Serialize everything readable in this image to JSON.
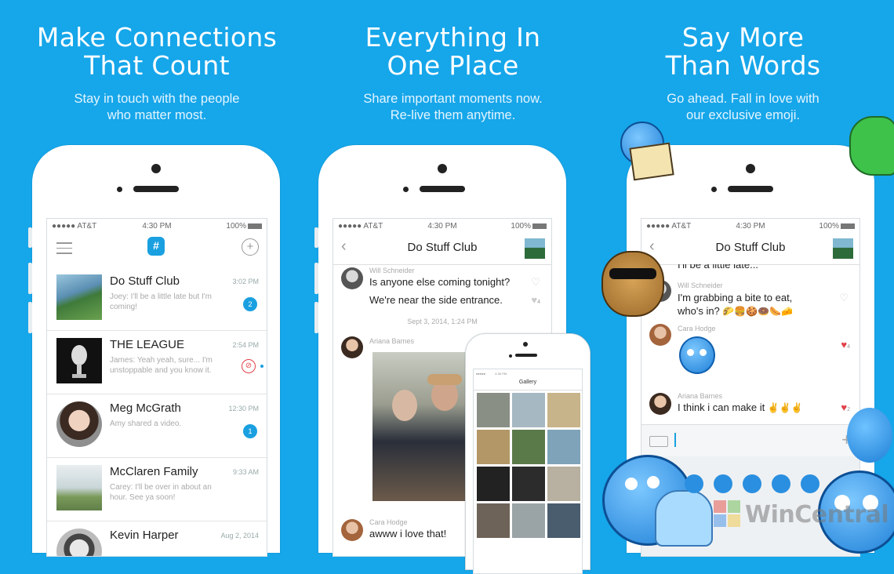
{
  "panels": [
    {
      "headline": [
        "Make Connections",
        "That Count"
      ],
      "sub": [
        "Stay in touch with the people",
        "who matter most."
      ]
    },
    {
      "headline": [
        "Everything In",
        "One Place"
      ],
      "sub": [
        "Share important moments now.",
        "Re-live them anytime."
      ]
    },
    {
      "headline": [
        "Say More",
        "Than Words"
      ],
      "sub": [
        "Go ahead. Fall in love with",
        "our exclusive emoji."
      ]
    }
  ],
  "status": {
    "carrier": "●●●●● AT&T",
    "time": "4:30 PM",
    "battery": "100%"
  },
  "phone1": {
    "conversations": [
      {
        "name": "Do Stuff Club",
        "time": "3:02 PM",
        "preview": "Joey: I'll be a little late but I'm coming!",
        "badge": "2"
      },
      {
        "name": "THE LEAGUE",
        "time": "2:54 PM",
        "preview": "James: Yeah yeah, sure... I'm unstoppable and you know it.",
        "badge": ""
      },
      {
        "name": "Meg McGrath",
        "time": "12:30 PM",
        "preview": "Amy shared a video.",
        "badge": "1"
      },
      {
        "name": "McClaren Family",
        "time": "9:33 AM",
        "preview": "Carey: I'll be over in about an hour. See ya soon!",
        "badge": ""
      },
      {
        "name": "Kevin Harper",
        "time": "Aug 2, 2014",
        "preview": "",
        "badge": ""
      }
    ]
  },
  "phone2": {
    "title": "Do Stuff Club",
    "sender1": "Will Schneider",
    "msg1": "Is anyone else coming tonight?",
    "msg2": "We're near the side entrance.",
    "heart_count": "4",
    "date": "Sept 3, 2014, 1:24 PM",
    "sender2": "Ariana Barnes",
    "sender3": "Cara Hodge",
    "msg3": "awww i love that!",
    "mini_title": "Gallery"
  },
  "phone3": {
    "title": "Do Stuff Club",
    "top_msg": "I'll be a little late...",
    "sender1": "Will Schneider",
    "msg1": [
      "I'm grabbing a bite to eat,",
      "who's in?"
    ],
    "sender2": "Cara Hodge",
    "heart2": "4",
    "sender3": "Ariana Barnes",
    "msg3": "I think i can make it",
    "heart3": "2"
  },
  "watermark": "WinCentral",
  "colors": {
    "background": "#16a6ea",
    "accent": "#1aa0e0",
    "heart": "#e2424a"
  }
}
